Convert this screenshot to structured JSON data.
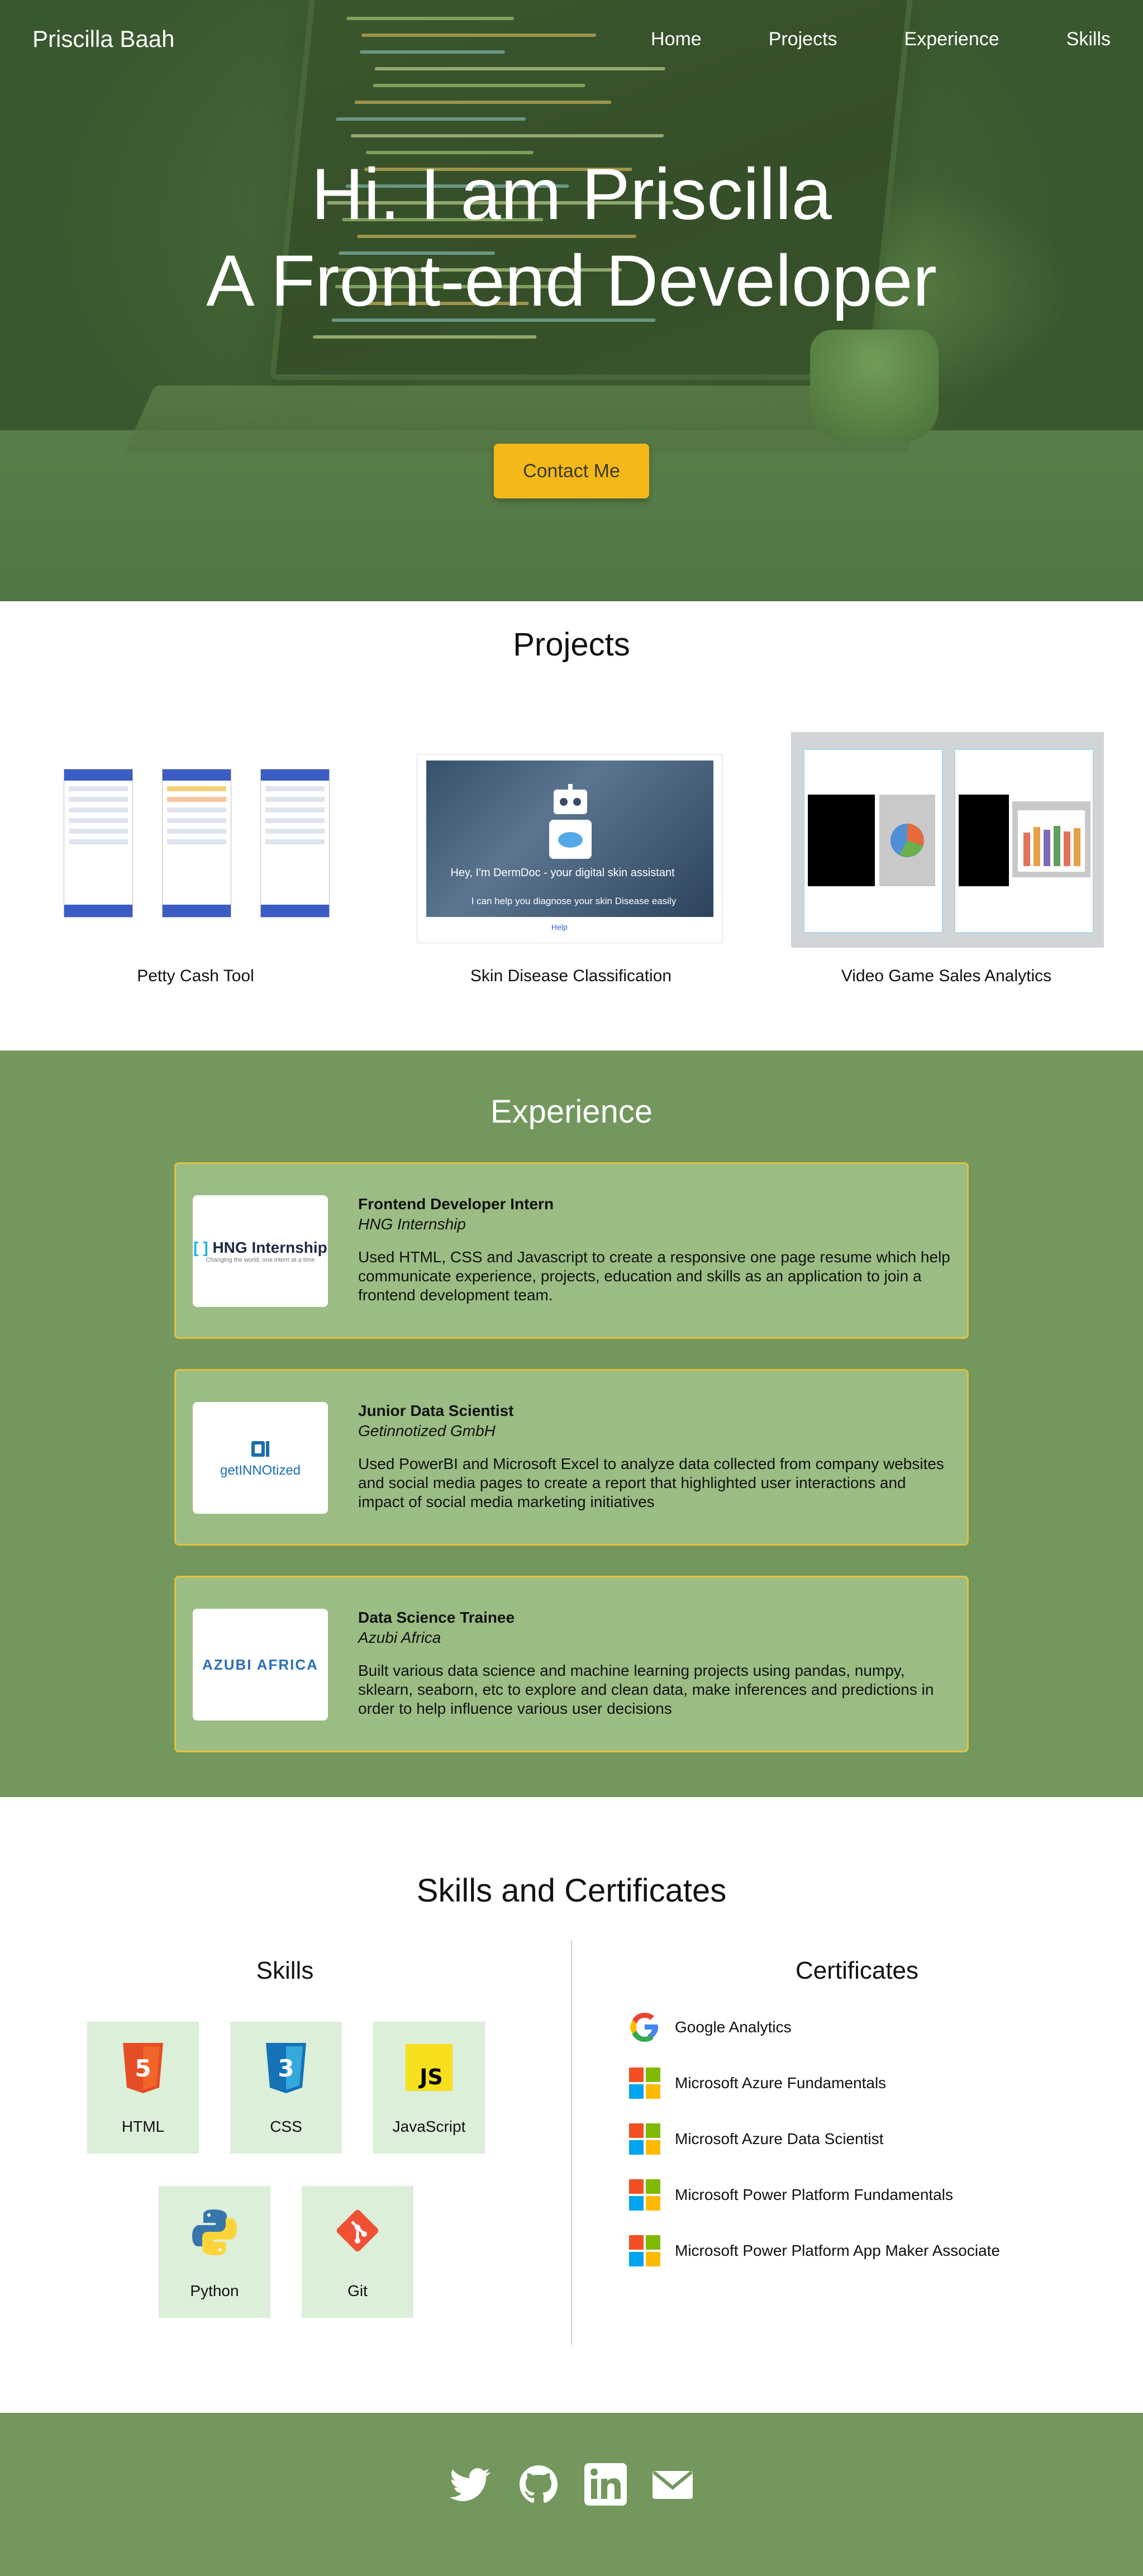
{
  "nav": {
    "brand": "Priscilla Baah",
    "links": [
      "Home",
      "Projects",
      "Experience",
      "Skills"
    ]
  },
  "hero": {
    "line1": "Hi. I am Priscilla",
    "line2": "A Front-end Developer",
    "cta": "Contact Me"
  },
  "projects": {
    "title": "Projects",
    "items": [
      {
        "caption": "Petty Cash Tool"
      },
      {
        "caption": "Skin Disease Classification",
        "image_text_1": "Hey, I'm DermDoc - your digital skin assistant",
        "image_text_2": "I can help you diagnose your skin Disease easily",
        "image_button": "Help"
      },
      {
        "caption": "Video Game Sales Analytics"
      }
    ]
  },
  "experience": {
    "title": "Experience",
    "items": [
      {
        "logo": "HNG Internship",
        "logo_sub": "Changing the world, one intern at a time",
        "role": "Frontend Developer Intern",
        "company": "HNG Internship",
        "desc": "Used HTML, CSS and Javascript to create a responsive one page resume which help communicate experience, projects, education and skills as an application to join a frontend development team."
      },
      {
        "logo": "getINNOtized",
        "role": "Junior Data Scientist",
        "company": "Getinnotized GmbH",
        "desc": "Used PowerBI and Microsoft Excel to analyze data collected from company websites and social media pages to create a report that highlighted user interactions and impact of social media marketing initiatives"
      },
      {
        "logo": "AZUBI AFRICA",
        "role": "Data Science Trainee",
        "company": "Azubi Africa",
        "desc": "Built various data science and machine learning projects using pandas, numpy, sklearn, seaborn, etc to explore and clean data, make inferences and predictions in order to help influence various user decisions"
      }
    ]
  },
  "skills": {
    "title": "Skills and Certificates",
    "skills_title": "Skills",
    "certs_title": "Certificates",
    "tiles": [
      {
        "label": "HTML",
        "icon": "html5-icon",
        "color": "#e44d26"
      },
      {
        "label": "CSS",
        "icon": "css3-icon",
        "color": "#1572b6"
      },
      {
        "label": "JavaScript",
        "icon": "javascript-icon",
        "color": "#f7df1e"
      },
      {
        "label": "Python",
        "icon": "python-icon",
        "color": "#3776ab"
      },
      {
        "label": "Git",
        "icon": "git-icon",
        "color": "#f05033"
      }
    ],
    "certificates": [
      {
        "label": "Google Analytics",
        "icon": "google-icon"
      },
      {
        "label": "Microsoft Azure Fundamentals",
        "icon": "microsoft-icon"
      },
      {
        "label": "Microsoft Azure Data Scientist",
        "icon": "microsoft-icon"
      },
      {
        "label": "Microsoft Power Platform Fundamentals",
        "icon": "microsoft-icon"
      },
      {
        "label": "Microsoft Power Platform App Maker Associate",
        "icon": "microsoft-icon"
      }
    ]
  },
  "footer": {
    "icons": [
      "twitter-icon",
      "github-icon",
      "linkedin-icon",
      "email-icon"
    ]
  },
  "colors": {
    "accent": "#f5b819",
    "green": "#73975c",
    "card": "#9bbd84",
    "card_border": "#e0c23b",
    "tile": "#dcefd9"
  }
}
